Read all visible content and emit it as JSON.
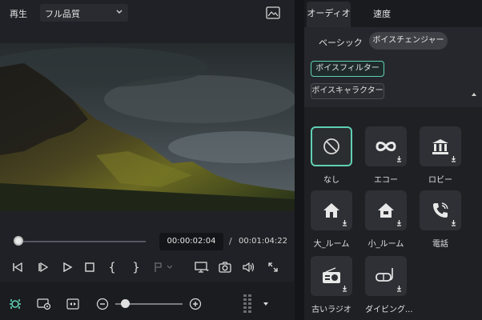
{
  "player": {
    "play_label": "再生",
    "quality": "フル品質",
    "current_time": "00:00:02:04",
    "time_separator": "/",
    "total_time": "00:01:04:22",
    "progress": 0.03,
    "zoom_level": 0.15
  },
  "panel": {
    "tabs": [
      {
        "label": "オーディオ",
        "active": true
      },
      {
        "label": "速度",
        "active": false
      }
    ],
    "subtabs": [
      {
        "label": "ベーシック",
        "active": false
      },
      {
        "label": "ボイスチェンジャー",
        "active": true
      }
    ],
    "categories": [
      {
        "label": "ボイスフィルター",
        "active": true
      },
      {
        "label": "ボイスキャラクター",
        "active": false
      }
    ],
    "presets": [
      {
        "label": "なし",
        "icon": "none-icon",
        "selected": true
      },
      {
        "label": "エコー",
        "icon": "infinity-icon",
        "selected": false
      },
      {
        "label": "ロビー",
        "icon": "building-icon",
        "selected": false
      },
      {
        "label": "大_ルーム",
        "icon": "house-icon",
        "selected": false
      },
      {
        "label": "小_ルーム",
        "icon": "small-house-icon",
        "selected": false
      },
      {
        "label": "電話",
        "icon": "phone-icon",
        "selected": false
      },
      {
        "label": "古いラジオ",
        "icon": "radio-icon",
        "selected": false
      },
      {
        "label": "ダイビング...",
        "icon": "diving-mask-icon",
        "selected": false
      }
    ]
  },
  "colors": {
    "accent": "#5fd0b4",
    "panel_bg": "#1f2024"
  }
}
